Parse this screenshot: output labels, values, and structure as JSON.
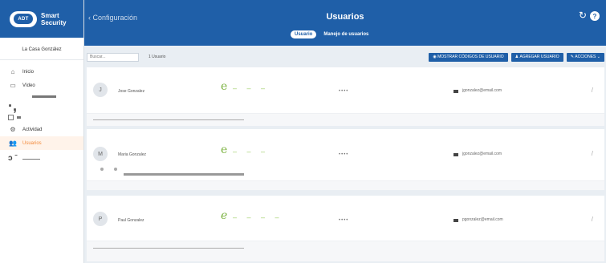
{
  "brand": {
    "logo": "ADT",
    "line1": "Smart",
    "line2": "Security"
  },
  "location": "La Casa González",
  "sidebar": {
    "items": [
      {
        "label": "Inicio",
        "icon": "home-icon"
      },
      {
        "label": "Vídeo",
        "icon": "video-icon"
      },
      {
        "label": "Actividad",
        "icon": "activity-icon"
      },
      {
        "label": "Usuarios",
        "icon": "users-icon"
      }
    ]
  },
  "header": {
    "back_label": "‹ Configuración",
    "title": "Usuarios",
    "tabs": [
      {
        "label": "Usuario"
      },
      {
        "label": "Manejo de usuarios"
      }
    ]
  },
  "toolbar": {
    "search_placeholder": "Buscar...",
    "count": "1 Usuario",
    "show_codes": "MOSTRAR CÓDIGOS DE USUARIO",
    "add_user": "AGREGAR USUARIO",
    "actions": "ACCIONES"
  },
  "users": [
    {
      "initial": "J",
      "name": "Jose Gonzalez",
      "pin_mask": "••••",
      "email": "jgonzalez@email.com"
    },
    {
      "initial": "M",
      "name": "Maria Gonzalez",
      "pin_mask": "••••",
      "email": "jgonzalez@email.com"
    },
    {
      "initial": "P",
      "name": "Paul Gonzalez",
      "pin_mask": "••••",
      "email": "pgonzalez@email.com"
    }
  ],
  "colors": {
    "brand": "#1f5fa8",
    "accent": "#f28a3c",
    "pin": "#7cb342"
  }
}
